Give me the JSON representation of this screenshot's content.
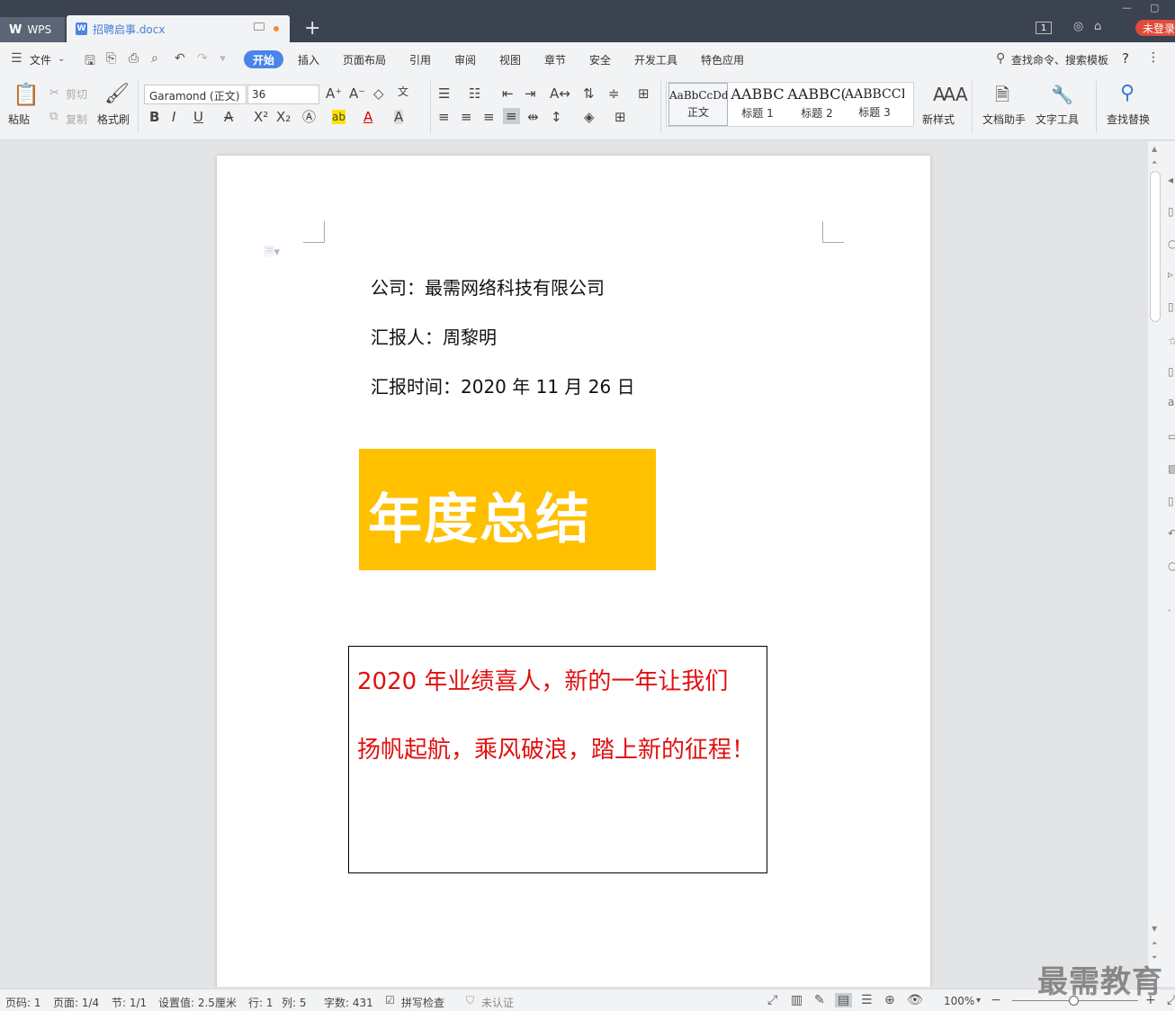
{
  "titlebar": {
    "app_tab": "WPS",
    "doc_tab": "招聘启事.docx",
    "doc_badge": "W",
    "add_tab": "+",
    "page_badge": "1",
    "login": "未登录"
  },
  "menubar": {
    "file": "文件",
    "items": [
      "开始",
      "插入",
      "页面布局",
      "引用",
      "审阅",
      "视图",
      "章节",
      "安全",
      "开发工具",
      "特色应用"
    ],
    "active": "开始",
    "search": "查找命令、搜索模板",
    "help": "?"
  },
  "ribbon": {
    "paste": "粘贴",
    "cut": "剪切",
    "copy": "复制",
    "format_painter": "格式刷",
    "font_name": "Garamond (正文)",
    "font_size": "36",
    "styles": [
      {
        "sample": "AaBbCcDd",
        "name": "正文"
      },
      {
        "sample": "AABBC",
        "name": "标题 1"
      },
      {
        "sample": "AABBC(",
        "name": "标题 2"
      },
      {
        "sample": "AABBCCI",
        "name": "标题 3"
      }
    ],
    "new_style": "新样式",
    "doc_helper": "文档助手",
    "text_tools": "文字工具",
    "find_replace": "查找替换"
  },
  "document": {
    "line1": "公司：最需网络科技有限公司",
    "line2": "汇报人：周黎明",
    "line3": "汇报时间：2020 年 11 月 26 日",
    "banner": "年度总结",
    "banner_color": "#ffc000",
    "textbox_line1": "2020 年业绩喜人，新的一年让我们",
    "textbox_line2": "扬帆起航，乘风破浪，踏上新的征程！",
    "text_color": "#e01010"
  },
  "statusbar": {
    "page_code": "页码: 1",
    "pages": "页面: 1/4",
    "section": "节: 1/1",
    "setting": "设置值: 2.5厘米",
    "row": "行: 1",
    "col": "列: 5",
    "word_count": "字数: 431",
    "spell_check": "拼写检查",
    "unverified": "未认证",
    "zoom": "100%"
  },
  "watermark": "最需教育"
}
